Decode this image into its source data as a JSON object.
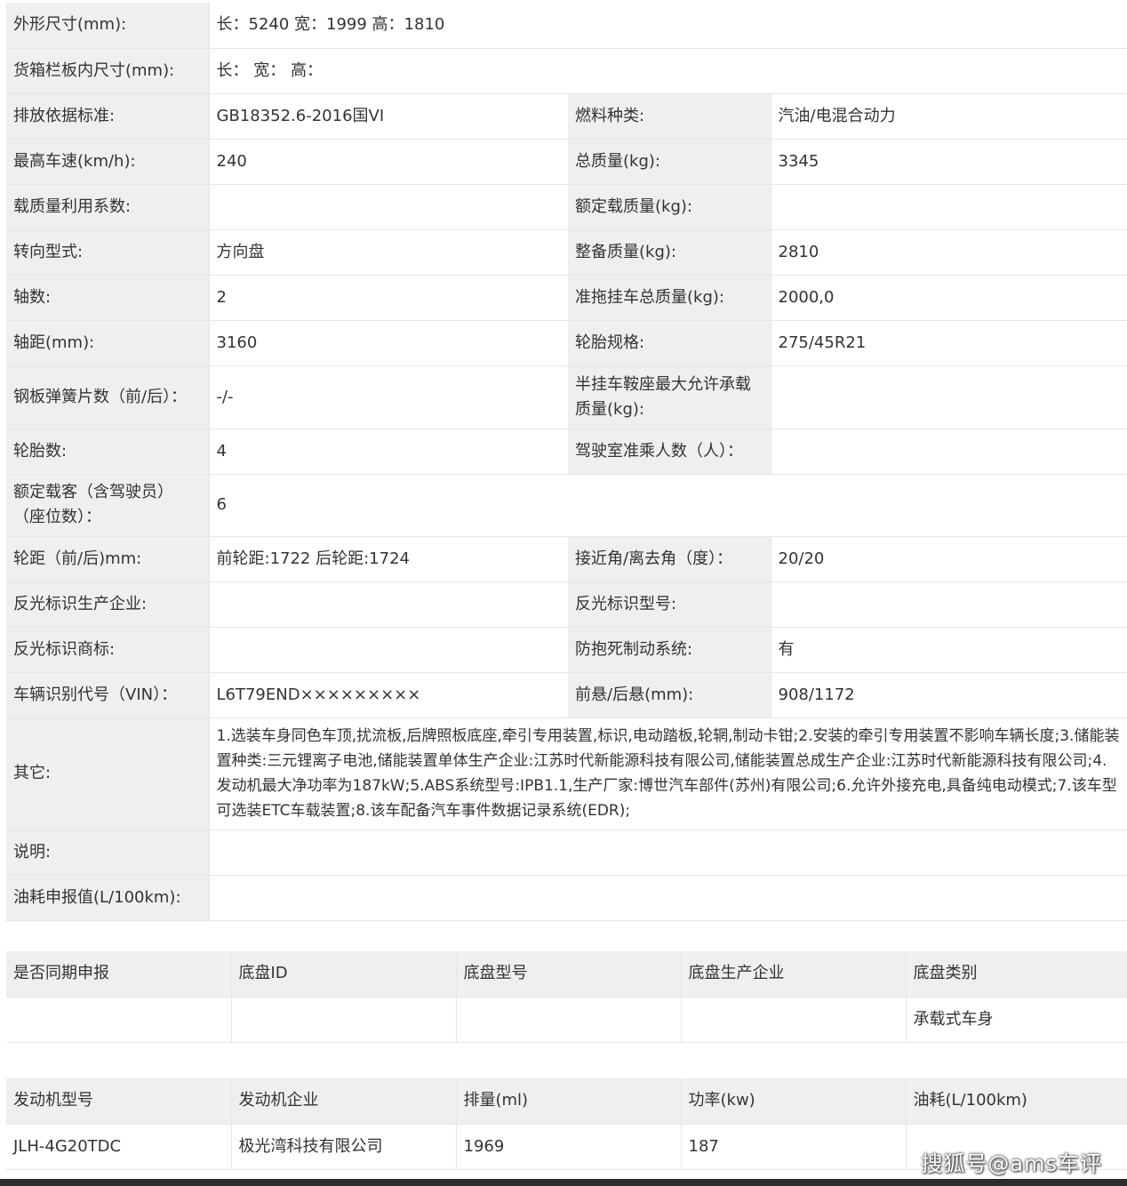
{
  "spec": {
    "r1": {
      "l": "外形尺寸(mm):",
      "v": "长：5240 宽：1999 高：1810"
    },
    "r2": {
      "l": "货箱栏板内尺寸(mm):",
      "v": "长：  宽：  高："
    },
    "r3": {
      "l1": "排放依据标准:",
      "v1": "GB18352.6-2016国VI",
      "l2": "燃料种类:",
      "v2": "汽油/电混合动力"
    },
    "r4": {
      "l1": "最高车速(km/h):",
      "v1": "240",
      "l2": "总质量(kg):",
      "v2": "3345"
    },
    "r5": {
      "l1": "载质量利用系数:",
      "v1": "",
      "l2": "额定载质量(kg):",
      "v2": ""
    },
    "r6": {
      "l1": "转向型式:",
      "v1": "方向盘",
      "l2": "整备质量(kg):",
      "v2": "2810"
    },
    "r7": {
      "l1": "轴数:",
      "v1": "2",
      "l2": "准拖挂车总质量(kg):",
      "v2": "2000,0"
    },
    "r8": {
      "l1": "轴距(mm):",
      "v1": "3160",
      "l2": "轮胎规格:",
      "v2": "275/45R21"
    },
    "r9": {
      "l1": "钢板弹簧片数（前/后）：",
      "v1": "-/-",
      "l2a": "半挂车鞍座最大允许承载",
      "l2b": "质量(kg):",
      "v2": ""
    },
    "r10": {
      "l1": "轮胎数:",
      "v1": "4",
      "l2": "驾驶室准乘人数（人）：",
      "v2": ""
    },
    "r11": {
      "la": "额定载客（含驾驶员）",
      "lb": "（座位数）：",
      "v": "6"
    },
    "r12": {
      "l1": "轮距（前/后)mm:",
      "v1": "前轮距:1722 后轮距:1724",
      "l2": "接近角/离去角（度）：",
      "v2": "20/20"
    },
    "r13": {
      "l1": "反光标识生产企业:",
      "v1": "",
      "l2": "反光标识型号:",
      "v2": ""
    },
    "r14": {
      "l1": "反光标识商标:",
      "v1": "",
      "l2": "防抱死制动系统:",
      "v2": "有"
    },
    "r15": {
      "l1": "车辆识别代号（VIN）：",
      "v1": "L6T79END×××××××××",
      "l2": "前悬/后悬(mm):",
      "v2": "908/1172"
    },
    "r16": {
      "l": "其它:",
      "v": "1.选装车身同色车顶,扰流板,后牌照板底座,牵引专用装置,标识,电动踏板,轮辋,制动卡钳;2.安装的牵引专用装置不影响车辆长度;3.储能装置种类:三元锂离子电池,储能装置单体生产企业:江苏时代新能源科技有限公司,储能装置总成生产企业:江苏时代新能源科技有限公司;4.发动机最大净功率为187kW;5.ABS系统型号:IPB1.1,生产厂家:博世汽车部件(苏州)有限公司;6.允许外接充电,具备纯电动模式;7.该车型可选装ETC车载装置;8.该车配备汽车事件数据记录系统(EDR);"
    },
    "r17": {
      "l": "说明:",
      "v": ""
    },
    "r18": {
      "l": "油耗申报值(L/100km):",
      "v": ""
    }
  },
  "chassis": {
    "headers": [
      "是否同期申报",
      "底盘ID",
      "底盘型号",
      "底盘生产企业",
      "底盘类别"
    ],
    "row": [
      "",
      "",
      "",
      "",
      "承载式车身"
    ]
  },
  "engine": {
    "headers": [
      "发动机型号",
      "发动机企业",
      "排量(ml)",
      "功率(kw)",
      "油耗(L/100km)"
    ],
    "row": [
      "JLH-4G20TDC",
      "极光湾科技有限公司",
      "1969",
      "187",
      ""
    ]
  },
  "watermark": "搜狐号@ams车评"
}
